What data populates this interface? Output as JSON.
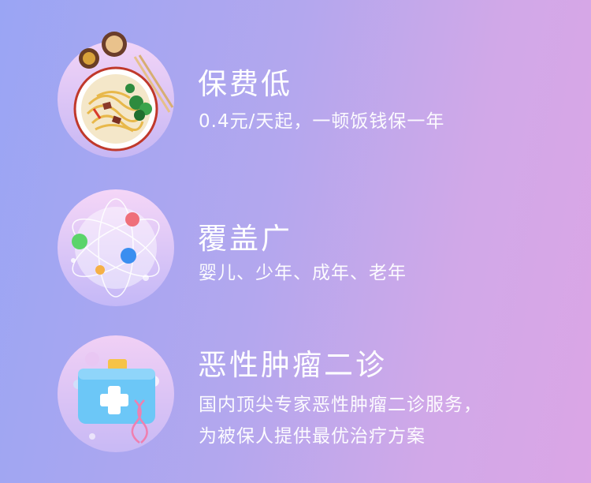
{
  "features": [
    {
      "title": "保费低",
      "subtitle": "0.4元/天起，一顿饭钱保一年",
      "icon": "noodle-bowl-icon"
    },
    {
      "title": "覆盖广",
      "subtitle": "婴儿、少年、成年、老年",
      "icon": "atom-orbit-icon"
    },
    {
      "title": "恶性肿瘤二诊",
      "subtitle_line1": "国内顶尖专家恶性肿瘤二诊服务，",
      "subtitle_line2": "为被保人提供最优治疗方案",
      "icon": "medical-kit-icon"
    }
  ],
  "colors": {
    "background_left": "#9aa5f4",
    "background_right": "#dba6e6",
    "text": "#ffffff"
  }
}
